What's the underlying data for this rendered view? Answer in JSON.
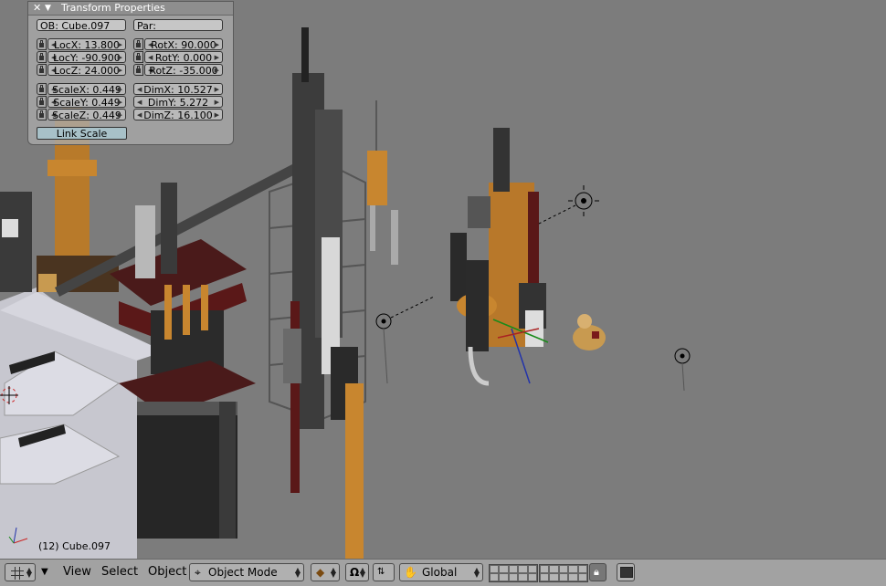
{
  "panel": {
    "title": "Transform Properties",
    "object_name": "OB: Cube.097",
    "parent": "Par:",
    "loc_x": "LocX: 13.800",
    "loc_y": "LocY: -90.900",
    "loc_z": "LocZ: 24.000",
    "rot_x": "RotX: 90.000",
    "rot_y": "RotY: 0.000",
    "rot_z": "RotZ: -35.000",
    "scale_x": "ScaleX: 0.449",
    "scale_y": "ScaleY: 0.449",
    "scale_z": "ScaleZ: 0.449",
    "dim_x": "DimX: 10.527",
    "dim_y": "DimY: 5.272",
    "dim_z": "DimZ: 16.100",
    "link_scale": "Link Scale"
  },
  "viewport": {
    "status": "(12) Cube.097"
  },
  "header": {
    "menus": [
      "View",
      "Select",
      "Object"
    ],
    "mode": "Object Mode",
    "orientation": "Global"
  }
}
